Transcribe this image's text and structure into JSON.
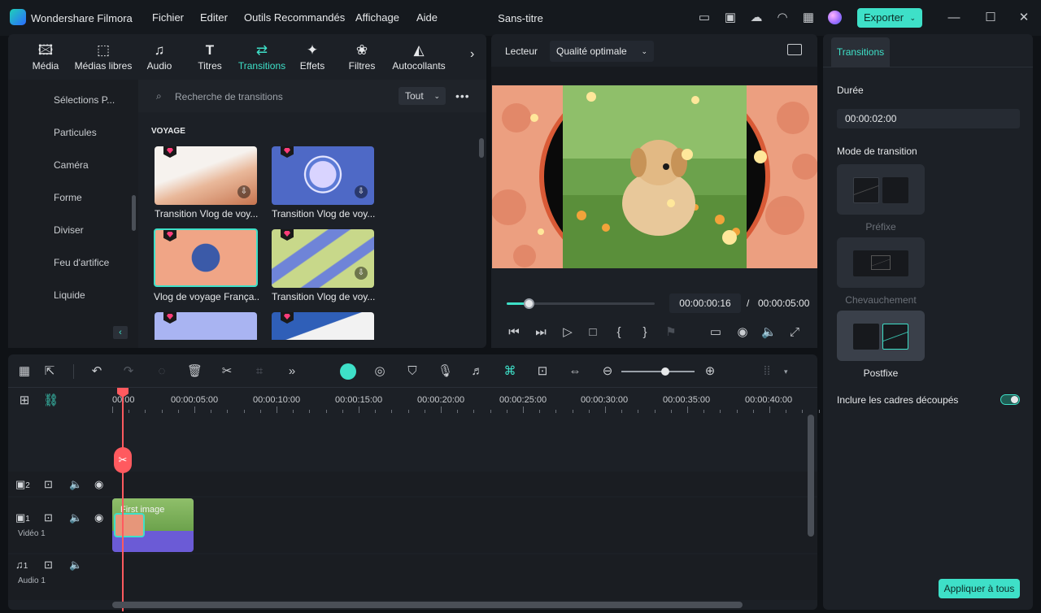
{
  "titlebar": {
    "app_name": "Wondershare Filmora",
    "menus": [
      "Fichier",
      "Editer",
      "Outils Recommandés",
      "Affichage",
      "Aide"
    ],
    "doc_title": "Sans-titre",
    "export_label": "Exporter"
  },
  "media_tabs": [
    {
      "label": "Média",
      "icon": "media-icon"
    },
    {
      "label": "Médias libres",
      "icon": "stock-media-icon"
    },
    {
      "label": "Audio",
      "icon": "music-note-icon"
    },
    {
      "label": "Titres",
      "icon": "text-icon"
    },
    {
      "label": "Transitions",
      "icon": "transitions-icon",
      "active": true
    },
    {
      "label": "Effets",
      "icon": "effects-icon"
    },
    {
      "label": "Filtres",
      "icon": "filters-icon"
    },
    {
      "label": "Autocollants",
      "icon": "stickers-icon"
    }
  ],
  "sidebar": {
    "items": [
      "Sélections P...",
      "Particules",
      "Caméra",
      "Forme",
      "Diviser",
      "Feu d'artifice",
      "Liquide"
    ]
  },
  "search": {
    "placeholder": "Recherche de transitions",
    "filter": "Tout"
  },
  "section_title": "VOYAGE",
  "transitions": [
    {
      "label": "Transition Vlog de voy..."
    },
    {
      "label": "Transition Vlog de voy..."
    },
    {
      "label": "Vlog de voyage França..."
    },
    {
      "label": "Transition Vlog de voy..."
    }
  ],
  "preview": {
    "player_label": "Lecteur",
    "quality": "Qualité optimale",
    "current_time": "00:00:00:16",
    "separator": "/",
    "total_time": "00:00:05:00",
    "progress": 0.15
  },
  "props": {
    "tab": "Transitions",
    "duration_label": "Durée",
    "duration_value": "00:00:02:00",
    "mode_label": "Mode de transition",
    "modes": [
      "Préfixe",
      "Chevauchement",
      "Postfixe"
    ],
    "selected_mode": "Postfixe",
    "include_label": "Inclure les cadres découpés",
    "include_on": true,
    "apply_all": "Appliquer à tous"
  },
  "timeline": {
    "ruler": [
      "00:00",
      "00:00:05:00",
      "00:00:10:00",
      "00:00:15:00",
      "00:00:20:00",
      "00:00:25:00",
      "00:00:30:00",
      "00:00:35:00",
      "00:00:40:00"
    ],
    "tracks": [
      {
        "num": "2",
        "name": ""
      },
      {
        "num": "1",
        "name": "Vidéo 1"
      },
      {
        "num": "1",
        "name": "Audio 1"
      }
    ],
    "clip_label": "First image"
  },
  "colors": {
    "accent": "#3ee0c8",
    "playhead": "#ff5a5f"
  }
}
